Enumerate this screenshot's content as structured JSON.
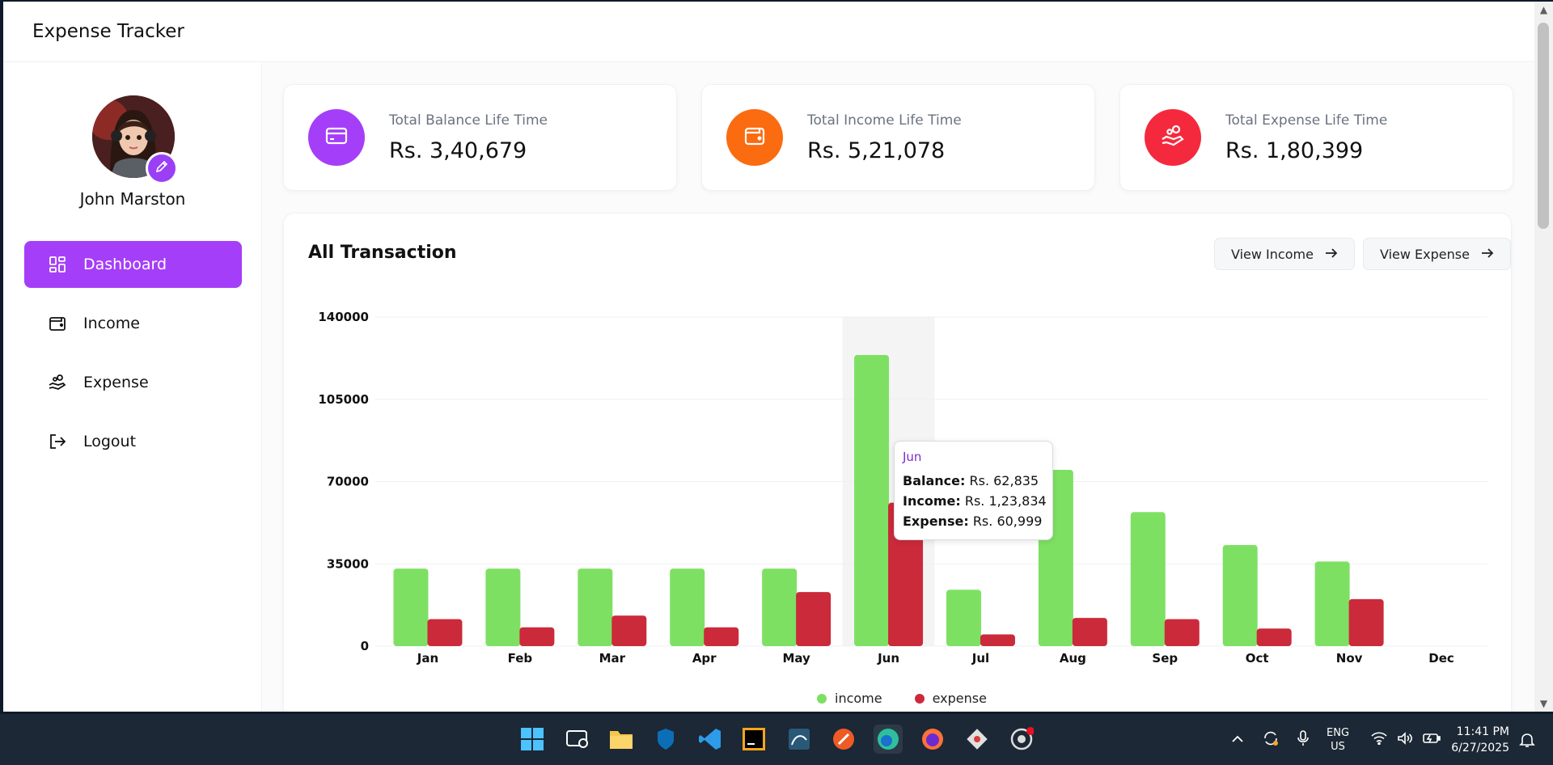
{
  "app": {
    "title": "Expense Tracker"
  },
  "user": {
    "name": "John Marston"
  },
  "nav": [
    {
      "label": "Dashboard",
      "icon": "dashboard-icon",
      "active": true
    },
    {
      "label": "Income",
      "icon": "wallet-icon",
      "active": false
    },
    {
      "label": "Expense",
      "icon": "hand-coins-icon",
      "active": false
    },
    {
      "label": "Logout",
      "icon": "logout-icon",
      "active": false
    }
  ],
  "cards": [
    {
      "label": "Total Balance Life Time",
      "value": "Rs. 3,40,679",
      "color": "#a53ef8",
      "icon": "credit-card-icon"
    },
    {
      "label": "Total Income Life Time",
      "value": "Rs. 5,21,078",
      "color": "#fb6b10",
      "icon": "wallet-icon"
    },
    {
      "label": "Total Expense Life Time",
      "value": "Rs. 1,80,399",
      "color": "#f5293d",
      "icon": "hand-coins-icon"
    }
  ],
  "panel": {
    "title": "All Transaction",
    "view_income": "View Income",
    "view_expense": "View Expense"
  },
  "chart_data": {
    "type": "bar",
    "categories": [
      "Jan",
      "Feb",
      "Mar",
      "Apr",
      "May",
      "Jun",
      "Jul",
      "Aug",
      "Sep",
      "Oct",
      "Nov",
      "Dec"
    ],
    "series": [
      {
        "name": "income",
        "color": "#7ee063",
        "values": [
          33000,
          33000,
          33000,
          33000,
          33000,
          123834,
          24000,
          75000,
          57000,
          43000,
          36000,
          0
        ]
      },
      {
        "name": "expense",
        "color": "#cb2a3a",
        "values": [
          11500,
          8000,
          13000,
          8000,
          23000,
          60999,
          5000,
          12000,
          11500,
          7500,
          20000,
          0
        ]
      }
    ],
    "yticks": [
      "0",
      "35000",
      "70000",
      "105000",
      "140000"
    ],
    "ylim": [
      0,
      140000
    ],
    "highlight": "Jun",
    "legend": "bottom-center",
    "grid": true
  },
  "tooltip": {
    "month": "Jun",
    "balance_label": "Balance:",
    "balance_value": "Rs. 62,835",
    "income_label": "Income:",
    "income_value": "Rs. 1,23,834",
    "expense_label": "Expense:",
    "expense_value": "Rs. 60,999"
  },
  "taskbar": {
    "lang": "ENG",
    "region": "US",
    "time": "11:41 PM",
    "date": "6/27/2025"
  }
}
